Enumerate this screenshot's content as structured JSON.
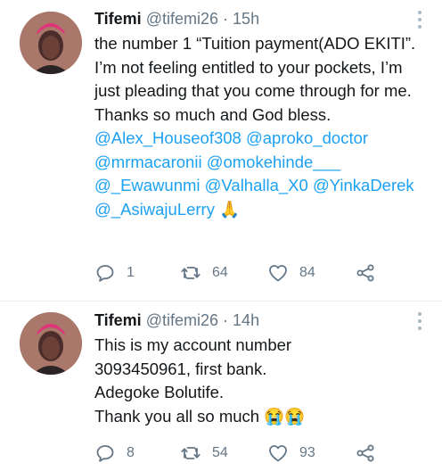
{
  "tweets": [
    {
      "name": "Tifemi",
      "handle": "@tifemi26",
      "separator": "·",
      "time": "15h",
      "text_1": "the number 1 “Tuition payment(ADO EKITI”. I’m not feeling entitled to your pockets, I’m just pleading that you come through for me. Thanks so much and God bless. ",
      "mentions": [
        "@Alex_Houseof308",
        "@aproko_doctor",
        "@mrmacaronii",
        "@omokehinde___",
        "@_Ewawunmi",
        "@Valhalla_X0",
        "@YinkaDerek",
        "@_AsiwajuLerry"
      ],
      "end_emoji": "🙏",
      "replies": "1",
      "retweets": "64",
      "likes": "84"
    },
    {
      "name": "Tifemi",
      "handle": "@tifemi26",
      "separator": "·",
      "time": "14h",
      "lines": [
        "This is my account number",
        "3093450961, first bank.",
        "Adegoke Bolutife.",
        "Thank you all so much "
      ],
      "end_emoji": "😭😭",
      "replies": "8",
      "retweets": "54",
      "likes": "93"
    }
  ],
  "icons": {
    "reply": "reply-icon",
    "retweet": "retweet-icon",
    "like": "heart-icon",
    "share": "share-icon",
    "more": "more-options-icon"
  },
  "colors": {
    "mention": "#1da1f2",
    "secondary_text": "#657786",
    "primary_text": "#14171a",
    "background": "#ffffff"
  }
}
